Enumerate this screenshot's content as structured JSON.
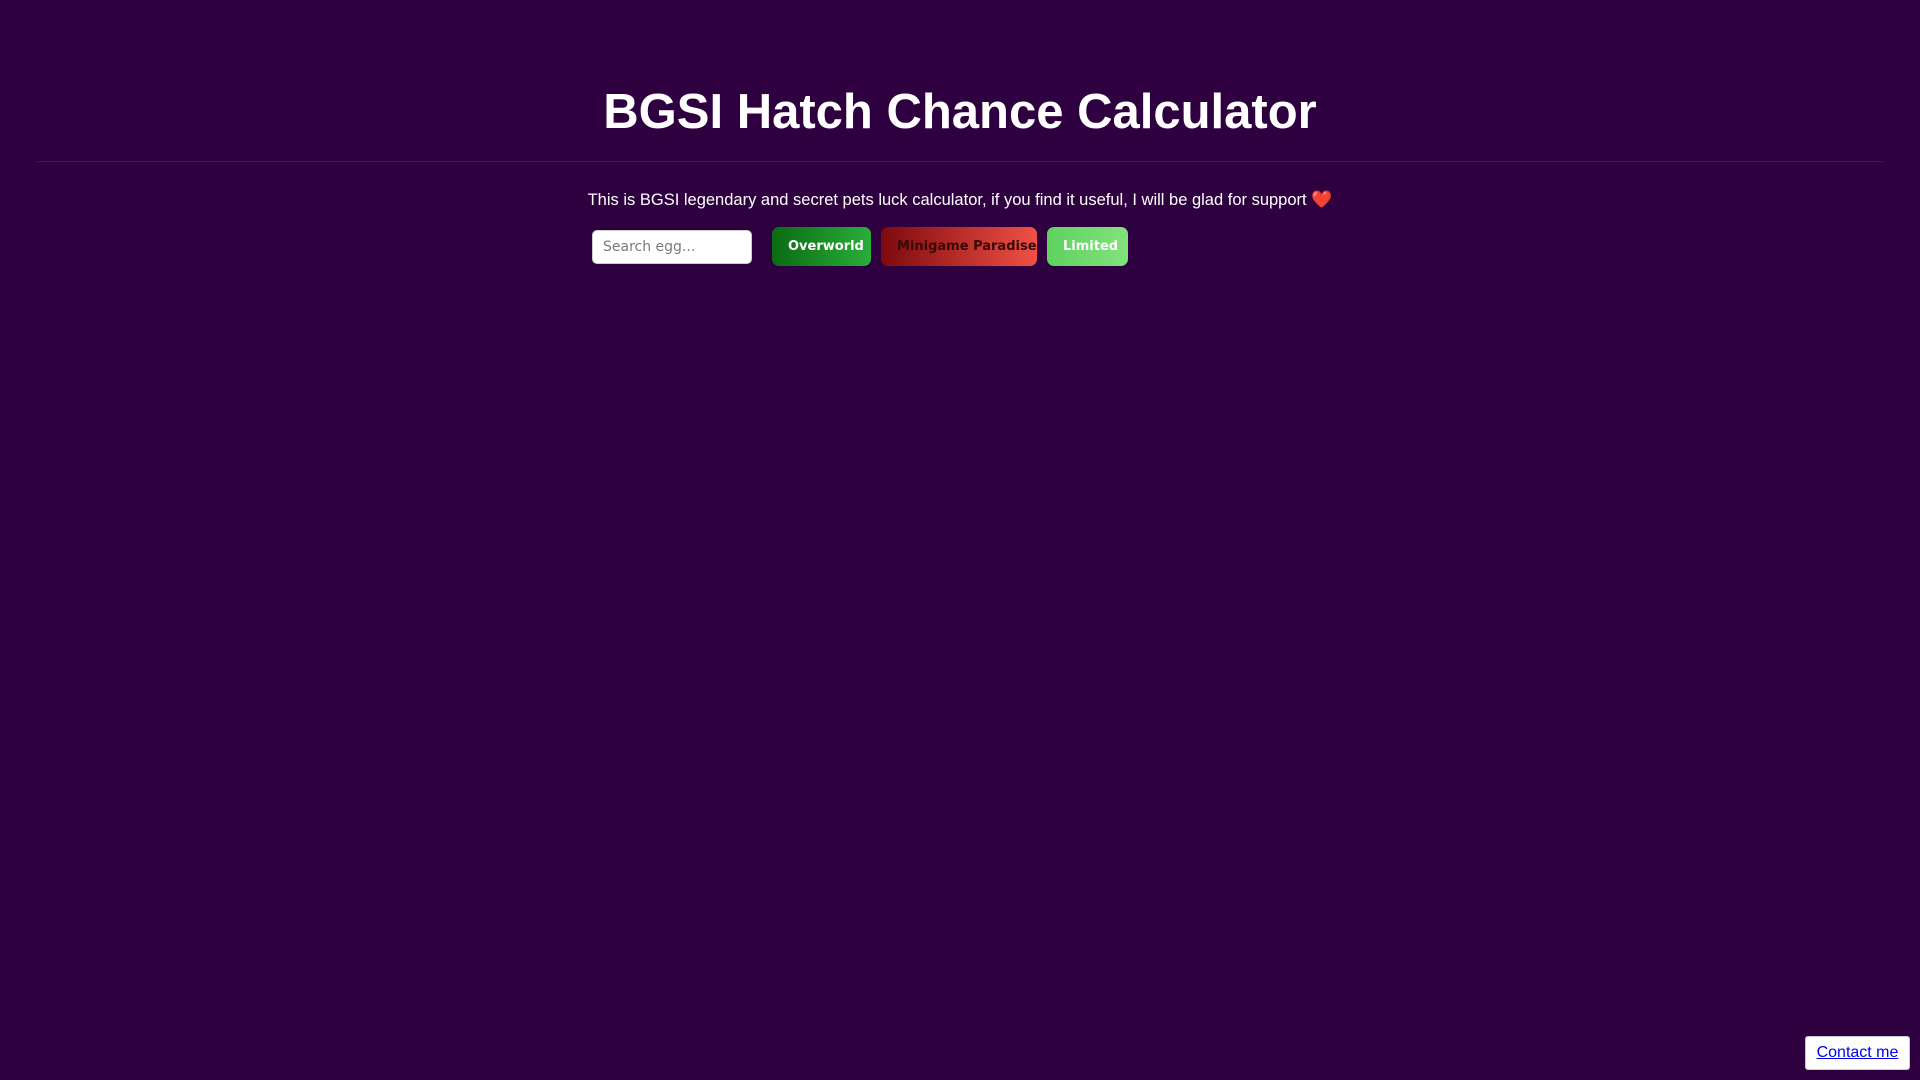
{
  "header": {
    "title": "BGSI Hatch Chance Calculator"
  },
  "intro": {
    "text": "This is BGSI legendary and secret pets luck calculator, if you find it useful, I will be glad for support",
    "heart": "❤️"
  },
  "search": {
    "placeholder": "Search egg...",
    "value": ""
  },
  "categories": {
    "overworld": "Overworld",
    "minigame_paradise": "Minigame Paradise",
    "limited": "Limited"
  },
  "footer": {
    "contact_label": "Contact me"
  },
  "colors": {
    "background": "#2e0040",
    "overworld_button": "#1a8d26",
    "minigame_button": "#c0302c",
    "limited_button": "#6fda6e",
    "contact_link": "#0000ee"
  }
}
